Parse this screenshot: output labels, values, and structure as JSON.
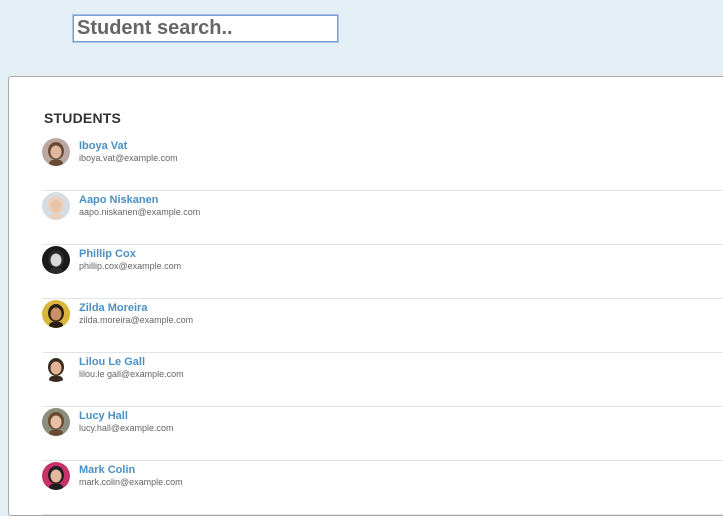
{
  "search": {
    "placeholder": "Student search..",
    "value": "Student search.."
  },
  "panel": {
    "title": "STUDENTS"
  },
  "students": [
    {
      "name": "Iboya Vat",
      "email": "iboya.vat@example.com",
      "avatar_bg": "#b9a9a0",
      "hair": "#6b4a35",
      "skin": "#e0b8a0"
    },
    {
      "name": "Aapo Niskanen",
      "email": "aapo.niskanen@example.com",
      "avatar_bg": "#d6dde2",
      "hair": "#e8d2bf",
      "skin": "#e8c3a8"
    },
    {
      "name": "Phillip Cox",
      "email": "phillip.cox@example.com",
      "avatar_bg": "#1a1a1a",
      "hair": "#2a2a2a",
      "skin": "#d9d9d9"
    },
    {
      "name": "Zilda Moreira",
      "email": "zilda.moreira@example.com",
      "avatar_bg": "#d9b53a",
      "hair": "#2b1e12",
      "skin": "#c89064"
    },
    {
      "name": "Lilou Le Gall",
      "email": "lilou.le gall@example.com",
      "avatar_bg": "#ffffff",
      "hair": "#3a2a22",
      "skin": "#e3b596"
    },
    {
      "name": "Lucy Hall",
      "email": "lucy.hall@example.com",
      "avatar_bg": "#8b8e7d",
      "hair": "#6a4a30",
      "skin": "#e6c0a6"
    },
    {
      "name": "Mark Colin",
      "email": "mark.colin@example.com",
      "avatar_bg": "#c8326a",
      "hair": "#1e1e1e",
      "skin": "#e4b89a"
    }
  ]
}
